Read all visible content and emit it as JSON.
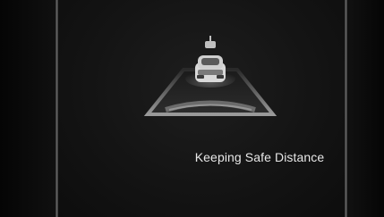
{
  "status": {
    "message": "Keeping Safe Distance"
  },
  "illustration": {
    "icon": "safe-distance-car-icon",
    "colors": {
      "lane_light": "#9a9a9a",
      "lane_dark": "#2a2a2a",
      "car_body": "#d9d9d9",
      "car_shadow": "#5a5a5a"
    }
  }
}
